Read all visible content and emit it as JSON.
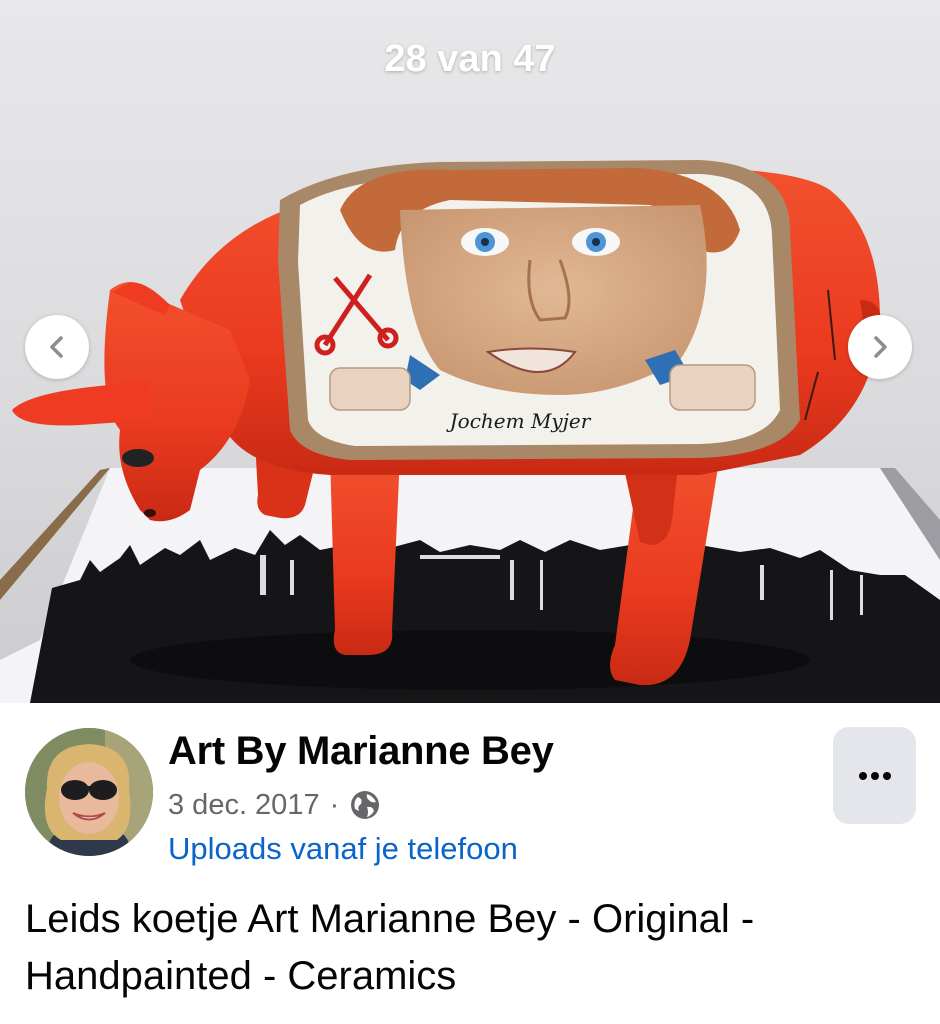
{
  "viewer": {
    "counter": "28 van 47",
    "photo_signature": "Jochem Myjer",
    "prev_icon": "chevron-left-icon",
    "next_icon": "chevron-right-icon"
  },
  "post": {
    "author": "Art By Marianne Bey",
    "date": "3 dec. 2017",
    "separator": "·",
    "privacy_icon": "globe-icon",
    "album": "Uploads vanaf je telefoon",
    "more_icon": "more-horizontal-icon",
    "caption": "Leids koetje Art Marianne Bey - Original - Handpainted - Ceramics"
  },
  "colors": {
    "album_link": "#0a64c9",
    "meta_text": "#65676b",
    "more_button_bg": "#e4e6eb",
    "cow_red": "#ee3b22"
  }
}
